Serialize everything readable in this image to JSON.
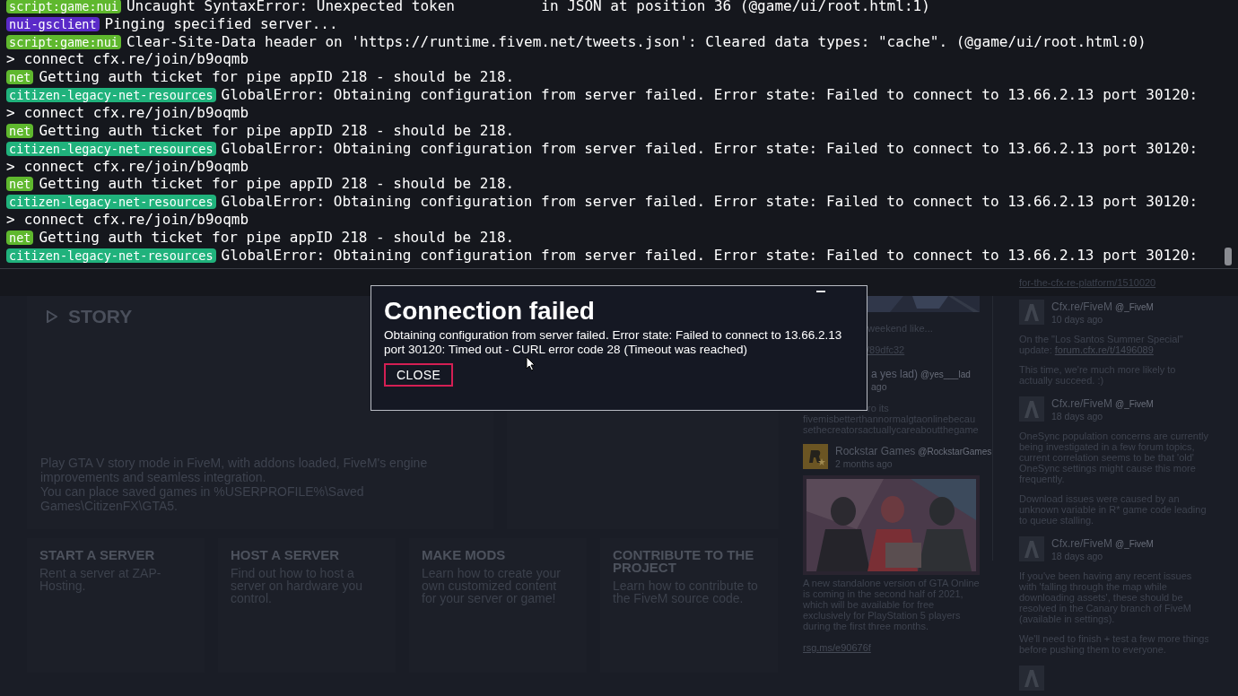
{
  "console": {
    "lines": [
      {
        "kind": "log",
        "tag": "script:game:nui",
        "color": "#5fb82e",
        "text": "Uncaught SyntaxError: Unexpected token          in JSON at position 36 (@game/ui/root.html:1)"
      },
      {
        "kind": "log",
        "tag": "nui-gsclient",
        "color": "#5a2ac8",
        "text": "Pinging specified server..."
      },
      {
        "kind": "log",
        "tag": "script:game:nui",
        "color": "#5fb82e",
        "text": "Clear-Site-Data header on 'https://runtime.fivem.net/tweets.json': Cleared data types: \"cache\". (@game/ui/root.html:0)"
      },
      {
        "kind": "command",
        "prompt": ">",
        "text": "connect cfx.re/join/b9oqmb"
      },
      {
        "kind": "log",
        "tag": "net",
        "color": "#5fb82e",
        "text": "Getting auth ticket for pipe appID 218 - should be 218."
      },
      {
        "kind": "log",
        "tag": "citizen-legacy-net-resources",
        "color": "#20b27c",
        "text": "GlobalError: Obtaining configuration from server failed. Error state: Failed to connect to 13.66.2.13 port 30120:"
      },
      {
        "kind": "command",
        "prompt": ">",
        "text": "connect cfx.re/join/b9oqmb"
      },
      {
        "kind": "log",
        "tag": "net",
        "color": "#5fb82e",
        "text": "Getting auth ticket for pipe appID 218 - should be 218."
      },
      {
        "kind": "log",
        "tag": "citizen-legacy-net-resources",
        "color": "#20b27c",
        "text": "GlobalError: Obtaining configuration from server failed. Error state: Failed to connect to 13.66.2.13 port 30120:"
      },
      {
        "kind": "command",
        "prompt": ">",
        "text": "connect cfx.re/join/b9oqmb"
      },
      {
        "kind": "log",
        "tag": "net",
        "color": "#5fb82e",
        "text": "Getting auth ticket for pipe appID 218 - should be 218."
      },
      {
        "kind": "log",
        "tag": "citizen-legacy-net-resources",
        "color": "#20b27c",
        "text": "GlobalError: Obtaining configuration from server failed. Error state: Failed to connect to 13.66.2.13 port 30120:"
      },
      {
        "kind": "command",
        "prompt": ">",
        "text": "connect cfx.re/join/b9oqmb"
      },
      {
        "kind": "log",
        "tag": "net",
        "color": "#5fb82e",
        "text": "Getting auth ticket for pipe appID 218 - should be 218."
      },
      {
        "kind": "log",
        "tag": "citizen-legacy-net-resources",
        "color": "#20b27c",
        "text": "GlobalError: Obtaining configuration from server failed. Error state: Failed to connect to 13.66.2.13 port 30120:"
      }
    ]
  },
  "dialog": {
    "title": "Connection failed",
    "message": "Obtaining configuration from server failed. Error state: Failed to connect to 13.66.2.13 port 30120: Timed out - CURL error code 28 (Timeout was reached)",
    "button": "CLOSE"
  },
  "home": {
    "story": {
      "title": "STORY",
      "paragraphs": [
        "Play GTA V story mode in FiveM, with addons loaded, FiveM's engine improvements and seamless integration.",
        "You can place saved games in %USERPROFILE%\\Saved Games\\CitizenFX\\GTA5."
      ]
    },
    "cards": [
      {
        "title": "START A SERVER",
        "text": "Rent a server at ZAP-Hosting."
      },
      {
        "title": "HOST A SERVER",
        "text": "Find out how to host a server on hardware you control."
      },
      {
        "title": "MAKE MODS",
        "text": "Learn how to create your own customized content for your server or game!"
      },
      {
        "title": "CONTRIBUTE TO THE PROJECT",
        "text": "Learn how to contribute to the FiveM source code."
      }
    ]
  },
  "feed": {
    "top_link": "for-the-cfx-re-platform/1510020",
    "left": [
      {
        "kind": "picture"
      },
      {
        "kind": "clipped_text",
        "text": "weekend like..."
      },
      {
        "kind": "clipped_link",
        "text": "/89dfc32"
      },
      {
        "kind": "clipped_author",
        "name": "a yes lad)",
        "handle": "@yes___lad",
        "time": "ago"
      },
      {
        "kind": "clipped_text",
        "text": "ro its"
      },
      {
        "kind": "word",
        "text": "fivemisbetterthannormalgtaonlinebecausethecreatorsactuallycareaboutthegame"
      },
      {
        "kind": "tweet",
        "avatar": {
          "kind": "rockstar"
        },
        "name": "Rockstar Games",
        "handle": "@RockstarGames",
        "time": "2 months ago",
        "media": {
          "kind": "picture"
        },
        "paragraphs": [
          {
            "text": "A new standalone version of GTA Online is coming in the second half of 2021, which will be available for free exclusively for PlayStation 5 players during the first three months."
          },
          {
            "link": "rsg.ms/e90676f"
          }
        ]
      }
    ],
    "right": [
      {
        "avatar": {
          "kind": "cfx"
        },
        "name": "Cfx.re/FiveM",
        "handle": "@_FiveM",
        "time": "10 days ago",
        "paragraphs": [
          {
            "text": "On the \"Los Santos Summer Special\" update: ",
            "link": "forum.cfx.re/t/1496089"
          },
          {
            "text": "This time, we're much more likely to actually succeed. :)"
          }
        ]
      },
      {
        "avatar": {
          "kind": "cfx"
        },
        "name": "Cfx.re/FiveM",
        "handle": "@_FiveM",
        "time": "18 days ago",
        "paragraphs": [
          {
            "text": "OneSync population concerns are currently being investigated in a few forum topics, current correlation seems to be that 'old' OneSync settings might cause this more frequently."
          },
          {
            "text": "Download issues were caused by an unknown variable in R* game code leading to queue stalling."
          }
        ]
      },
      {
        "avatar": {
          "kind": "cfx"
        },
        "name": "Cfx.re/FiveM",
        "handle": "@_FiveM",
        "time": "18 days ago",
        "paragraphs": [
          {
            "text": "If you've been having any recent issues with 'falling through the map while downloading assets', these should be resolved in the Canary branch of FiveM (available in settings)."
          },
          {
            "text": "We'll need to finish + test a few more things before pushing them to everyone."
          }
        ]
      },
      {
        "avatar": {
          "kind": "cfx"
        }
      }
    ]
  }
}
